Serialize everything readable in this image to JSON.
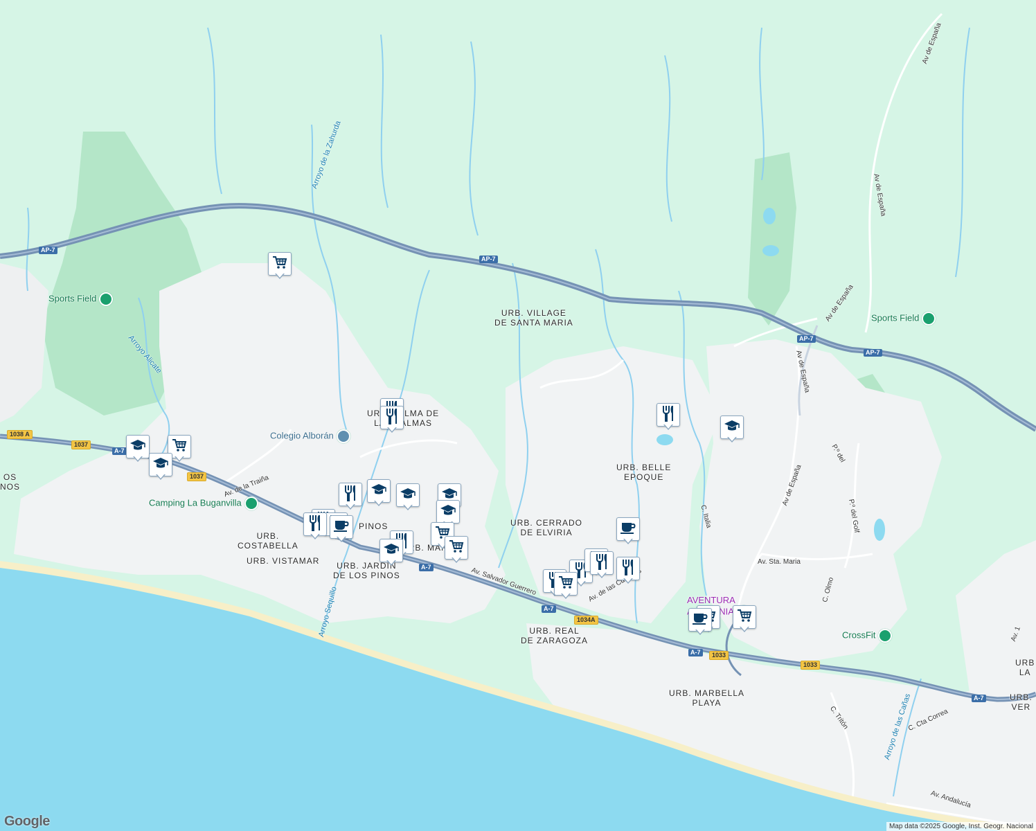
{
  "colors": {
    "land": "#d6f5e6",
    "urban": "#f1f3f4",
    "park": "#b4e6c8",
    "sea": "#8ddaf0",
    "beach": "#f7efc8",
    "highway": "#6b8fb7",
    "stream": "#8fd0ef",
    "road": "#ffffff"
  },
  "areas": [
    {
      "id": "village-santa-maria",
      "text": "URB. VILLAGE\nDE SANTA MARIA"
    },
    {
      "id": "palma-de-las-palmas",
      "text": "URB. PALMA DE\nLAS PALMAS"
    },
    {
      "id": "belle-epoque",
      "text": "URB. BELLE\nEPOQUE"
    },
    {
      "id": "cerrado-elviria",
      "text": "URB. CERRADO\nDE ELVIRIA"
    },
    {
      "id": "costabella",
      "text": "URB.\nCOSTABELLA"
    },
    {
      "id": "vistamar",
      "text": "URB. VISTAMAR"
    },
    {
      "id": "jardin-pinos",
      "text": "URB. JARDIN\nDE LOS PINOS"
    },
    {
      "id": "pinos",
      "text": "PINOS"
    },
    {
      "id": "urb-mar",
      "text": "URB. MAR"
    },
    {
      "id": "real-zaragoza",
      "text": "URB. REAL\nDE ZARAGOZA"
    },
    {
      "id": "marbella-playa",
      "text": "URB. MARBELLA\nPLAYA"
    },
    {
      "id": "edge-pinos",
      "text": "OS\nNOS"
    },
    {
      "id": "edge-urb-la",
      "text": "URB\nLA"
    },
    {
      "id": "edge-urb-ver",
      "text": "URB.\nVER"
    }
  ],
  "places": [
    {
      "id": "sports-field-west",
      "text": "Sports Field",
      "kind": "park"
    },
    {
      "id": "sports-field-east",
      "text": "Sports Field",
      "kind": "park"
    },
    {
      "id": "colegio-alboran",
      "text": "Colegio Alborán",
      "kind": "edu"
    },
    {
      "id": "camping-buganvilla",
      "text": "Camping La Buganvilla",
      "kind": "camp"
    },
    {
      "id": "crossfit",
      "text": "CrossFit",
      "kind": "park"
    },
    {
      "id": "aventura-amaz",
      "text": "AVENTURA\nAMAZONIA",
      "kind": "ent"
    }
  ],
  "roads": [
    {
      "id": "av-espana-1",
      "text": "Av de España"
    },
    {
      "id": "av-espana-2",
      "text": "Av de España"
    },
    {
      "id": "av-espana-3",
      "text": "Av de España"
    },
    {
      "id": "av-espana-4",
      "text": "Av de España"
    },
    {
      "id": "av-espana-5",
      "text": "Av de España"
    },
    {
      "id": "av-traina",
      "text": "Av. de la Traiña"
    },
    {
      "id": "av-salvador",
      "text": "Av. Salvador Guerrero"
    },
    {
      "id": "av-cumbres",
      "text": "Av. de las Cumbres"
    },
    {
      "id": "c-italia",
      "text": "C. Italia"
    },
    {
      "id": "av-sta-maria",
      "text": "Av. Sta. Maria"
    },
    {
      "id": "c-olmo",
      "text": "C. Olmo"
    },
    {
      "id": "po-golf",
      "text": "P.º del Golf"
    },
    {
      "id": "po-golf-2",
      "text": "P.º del"
    },
    {
      "id": "c-triton",
      "text": "C. Tritón"
    },
    {
      "id": "c-cta-correa",
      "text": "C. Cta Correa"
    },
    {
      "id": "av-andalucia",
      "text": "Av. Andalucía"
    },
    {
      "id": "av-1",
      "text": "Av. 1"
    }
  ],
  "streams": [
    {
      "id": "arroyo-zahurda",
      "text": "Arroyo de la Zahurda"
    },
    {
      "id": "arroyo-alicate",
      "text": "Arroyo Alicate"
    },
    {
      "id": "arroyo-sequillo",
      "text": "Arroyo Sequillo"
    },
    {
      "id": "arroyo-canas",
      "text": "Arroyo de las Cañas"
    }
  ],
  "shields": [
    {
      "id": "ap7-a",
      "text": "AP-7",
      "style": "blue"
    },
    {
      "id": "ap7-b",
      "text": "AP-7",
      "style": "blue"
    },
    {
      "id": "ap7-c",
      "text": "AP-7",
      "style": "blue"
    },
    {
      "id": "ap7-d",
      "text": "AP-7",
      "style": "blue"
    },
    {
      "id": "a7-a",
      "text": "A-7",
      "style": "blue"
    },
    {
      "id": "a7-b",
      "text": "A-7",
      "style": "blue"
    },
    {
      "id": "a7-c",
      "text": "A-7",
      "style": "blue"
    },
    {
      "id": "a7-d",
      "text": "A-7",
      "style": "blue"
    },
    {
      "id": "a7-e",
      "text": "A-7",
      "style": "blue"
    },
    {
      "id": "r1038a",
      "text": "1038 A",
      "style": "yellow"
    },
    {
      "id": "r1037a",
      "text": "1037",
      "style": "yellow"
    },
    {
      "id": "r1037b",
      "text": "1037",
      "style": "yellow"
    },
    {
      "id": "r1034a",
      "text": "1034A",
      "style": "yellow"
    },
    {
      "id": "r1033a",
      "text": "1033",
      "style": "yellow"
    },
    {
      "id": "r1033b",
      "text": "1033",
      "style": "yellow"
    }
  ],
  "markers": [
    {
      "icon": "cart-icon"
    },
    {
      "icon": "school-icon"
    },
    {
      "icon": "cart-icon"
    },
    {
      "icon": "school-icon"
    },
    {
      "icon": "restaurant-icon"
    },
    {
      "icon": "restaurant-icon"
    },
    {
      "icon": "restaurant-icon"
    },
    {
      "icon": "school-icon"
    },
    {
      "icon": "school-icon"
    },
    {
      "icon": "school-icon"
    },
    {
      "icon": "school-icon"
    },
    {
      "icon": "restaurant-icon"
    },
    {
      "icon": "restaurant-icon"
    },
    {
      "icon": "restaurant-icon"
    },
    {
      "icon": "cafe-icon"
    },
    {
      "icon": "restaurant-icon"
    },
    {
      "icon": "school-icon"
    },
    {
      "icon": "cart-icon"
    },
    {
      "icon": "cart-icon"
    },
    {
      "icon": "restaurant-icon"
    },
    {
      "icon": "cafe-icon"
    },
    {
      "icon": "school-icon"
    },
    {
      "icon": "restaurant-icon"
    },
    {
      "icon": "restaurant-icon"
    },
    {
      "icon": "restaurant-icon"
    },
    {
      "icon": "restaurant-icon"
    },
    {
      "icon": "restaurant-icon"
    },
    {
      "icon": "cart-icon"
    },
    {
      "icon": "cart-icon"
    },
    {
      "icon": "cafe-icon"
    },
    {
      "icon": "cart-icon"
    }
  ],
  "google_logo": "Google",
  "attribution": "Map data ©2025 Google, Inst. Geogr. Nacional"
}
